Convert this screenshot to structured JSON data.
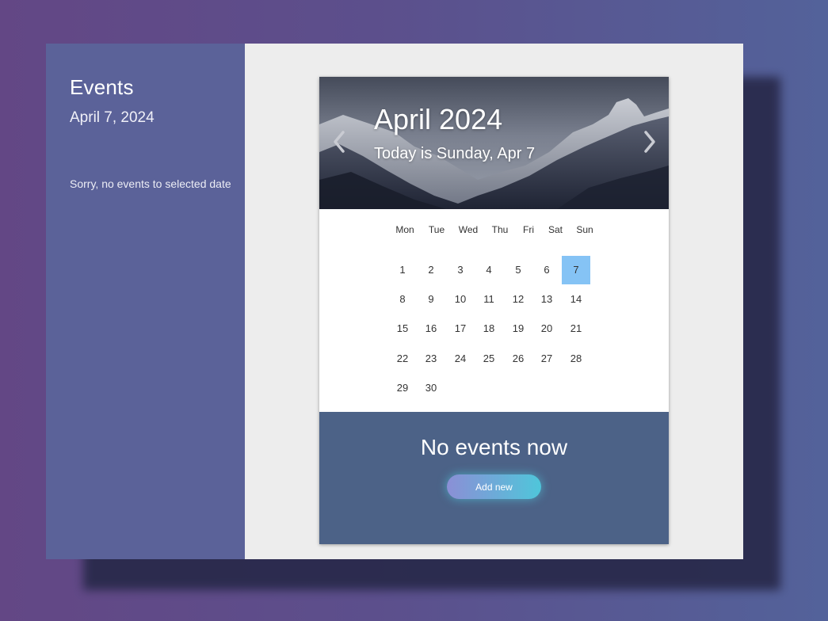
{
  "sidebar": {
    "title": "Events",
    "date": "April 7, 2024",
    "empty_message": "Sorry, no events to selected date"
  },
  "calendar": {
    "month_title": "April 2024",
    "today_text": "Today is Sunday, Apr 7",
    "weekdays": [
      "Mon",
      "Tue",
      "Wed",
      "Thu",
      "Fri",
      "Sat",
      "Sun"
    ],
    "weeks": [
      [
        "1",
        "2",
        "3",
        "4",
        "5",
        "6",
        "7"
      ],
      [
        "8",
        "9",
        "10",
        "11",
        "12",
        "13",
        "14"
      ],
      [
        "15",
        "16",
        "17",
        "18",
        "19",
        "20",
        "21"
      ],
      [
        "22",
        "23",
        "24",
        "25",
        "26",
        "27",
        "28"
      ],
      [
        "29",
        "30"
      ]
    ],
    "selected_day": "7",
    "prev_icon": "chevron-left-icon",
    "next_icon": "chevron-right-icon"
  },
  "events_panel": {
    "empty_title": "No events now",
    "add_button": "Add new"
  },
  "colors": {
    "sidebar": "#5b6299",
    "selected_day": "#85c3f5",
    "events_panel": "#4c6287",
    "button_gradient_start": "#8b8fd6",
    "button_gradient_end": "#4fc6da"
  }
}
